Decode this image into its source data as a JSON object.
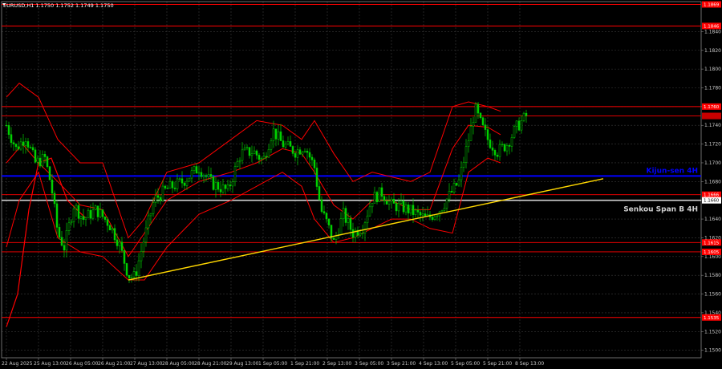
{
  "chart_data": {
    "type": "candlestick",
    "symbol_header": "EURUSD,H1  1.1750 1.1752 1.1749 1.1750",
    "y_axis_ticks": [
      "1.1840",
      "1.1820",
      "1.1800",
      "1.1780",
      "1.1760",
      "1.1740",
      "1.1720",
      "1.1700",
      "1.1680",
      "1.1660",
      "1.1640",
      "1.1620",
      "1.1600",
      "1.1580",
      "1.1560",
      "1.1540",
      "1.1520",
      "1.1500"
    ],
    "x_axis_ticks": [
      "22 Aug 2025",
      "25 Aug 13:00",
      "26 Aug 05:00",
      "26 Aug 21:00",
      "27 Aug 13:00",
      "28 Aug 05:00",
      "28 Aug 21:00",
      "29 Aug 13:00",
      "1 Sep 05:00",
      "1 Sep 21:00",
      "2 Sep 13:00",
      "3 Sep 05:00",
      "3 Sep 21:00",
      "4 Sep 13:00",
      "5 Sep 05:00",
      "5 Sep 21:00",
      "8 Sep 13:00"
    ],
    "ylim": [
      1.1492,
      1.1872
    ],
    "levels": [
      {
        "price": 1.1869,
        "label": "1.1869",
        "color": "#ff0000"
      },
      {
        "price": 1.1846,
        "label": "1.1846",
        "color": "#ff0000"
      },
      {
        "price": 1.176,
        "label": "1.1760",
        "color": "#ff0000"
      },
      {
        "price": 1.175,
        "label": "1.1750",
        "color": "#ff0000"
      },
      {
        "price": 1.1666,
        "label": "1.1666",
        "color": "#ff0000"
      },
      {
        "price": 1.1615,
        "label": "1.1615",
        "color": "#ff0000"
      },
      {
        "price": 1.1605,
        "label": "1.1605",
        "color": "#ff0000"
      },
      {
        "price": 1.1535,
        "label": "1.1535",
        "color": "#ff0000"
      }
    ],
    "kijun": {
      "price": 1.1686,
      "label": "Kijun-sen 4H",
      "color": "#0000ff"
    },
    "senkou": {
      "price": 1.166,
      "label": "Senkou Span B 4H",
      "tag": "1.1660",
      "color": "#d0d0d0"
    },
    "current_price": {
      "price": 1.175,
      "tag": "1.1750"
    },
    "trendline": {
      "from": [
        3.8,
        1.1575
      ],
      "to": [
        18.6,
        1.1683
      ],
      "color": "#ffd700"
    },
    "candle_color": "#00d000",
    "indicator_color": "#ff0000",
    "bands": {
      "upper": [
        [
          0,
          1.177
        ],
        [
          0.4,
          1.1785
        ],
        [
          1.0,
          1.177
        ],
        [
          1.6,
          1.1725
        ],
        [
          2.3,
          1.17
        ],
        [
          3.0,
          1.17
        ],
        [
          3.8,
          1.162
        ],
        [
          4.3,
          1.164
        ],
        [
          5.0,
          1.169
        ],
        [
          6.0,
          1.17
        ],
        [
          7.0,
          1.1725
        ],
        [
          7.8,
          1.1745
        ],
        [
          8.6,
          1.174
        ],
        [
          9.2,
          1.1725
        ],
        [
          9.6,
          1.1745
        ],
        [
          10.2,
          1.171
        ],
        [
          10.8,
          1.168
        ],
        [
          11.4,
          1.169
        ],
        [
          12.0,
          1.1685
        ],
        [
          12.6,
          1.168
        ],
        [
          13.2,
          1.169
        ],
        [
          13.9,
          1.176
        ],
        [
          14.4,
          1.1765
        ],
        [
          15.0,
          1.176
        ],
        [
          15.4,
          1.1755
        ]
      ],
      "middle": [
        [
          0,
          1.17
        ],
        [
          0.5,
          1.172
        ],
        [
          1.0,
          1.17
        ],
        [
          1.6,
          1.168
        ],
        [
          2.3,
          1.1655
        ],
        [
          3.0,
          1.165
        ],
        [
          3.8,
          1.16
        ],
        [
          4.3,
          1.1625
        ],
        [
          5.0,
          1.166
        ],
        [
          6.0,
          1.168
        ],
        [
          7.0,
          1.169
        ],
        [
          7.8,
          1.17
        ],
        [
          8.6,
          1.1715
        ],
        [
          9.2,
          1.171
        ],
        [
          9.6,
          1.169
        ],
        [
          10.2,
          1.1655
        ],
        [
          10.8,
          1.164
        ],
        [
          11.4,
          1.166
        ],
        [
          12.0,
          1.166
        ],
        [
          12.6,
          1.165
        ],
        [
          13.2,
          1.165
        ],
        [
          13.9,
          1.1715
        ],
        [
          14.4,
          1.174
        ],
        [
          15.0,
          1.1738
        ],
        [
          15.4,
          1.173
        ]
      ],
      "lower": [
        [
          0,
          1.161
        ],
        [
          0.4,
          1.166
        ],
        [
          1.0,
          1.169
        ],
        [
          1.6,
          1.162
        ],
        [
          2.3,
          1.1605
        ],
        [
          3.0,
          1.16
        ],
        [
          3.8,
          1.1575
        ],
        [
          4.3,
          1.1575
        ],
        [
          5.0,
          1.161
        ],
        [
          6.0,
          1.1645
        ],
        [
          7.0,
          1.166
        ],
        [
          7.8,
          1.1675
        ],
        [
          8.6,
          1.169
        ],
        [
          9.2,
          1.1675
        ],
        [
          9.6,
          1.164
        ],
        [
          10.2,
          1.1615
        ],
        [
          10.8,
          1.162
        ],
        [
          11.4,
          1.163
        ],
        [
          12.0,
          1.164
        ],
        [
          12.6,
          1.164
        ],
        [
          13.2,
          1.163
        ],
        [
          13.9,
          1.1625
        ],
        [
          14.4,
          1.169
        ],
        [
          15.0,
          1.1705
        ],
        [
          15.4,
          1.17
        ]
      ],
      "ma_long": [
        [
          0,
          1.1525
        ],
        [
          0.35,
          1.156
        ],
        [
          0.7,
          1.165
        ],
        [
          1.0,
          1.17
        ],
        [
          1.4,
          1.1705
        ],
        [
          1.9,
          1.166
        ],
        [
          2.5,
          1.164
        ]
      ]
    },
    "price_path": [
      [
        0.0,
        1.174
      ],
      [
        0.3,
        1.1715
      ],
      [
        0.6,
        1.1728
      ],
      [
        0.9,
        1.17
      ],
      [
        1.2,
        1.1705
      ],
      [
        1.4,
        1.1675
      ],
      [
        1.6,
        1.1625
      ],
      [
        1.8,
        1.161
      ],
      [
        2.1,
        1.1655
      ],
      [
        2.4,
        1.164
      ],
      [
        2.8,
        1.165
      ],
      [
        3.2,
        1.1635
      ],
      [
        3.5,
        1.1615
      ],
      [
        3.8,
        1.158
      ],
      [
        4.0,
        1.1578
      ],
      [
        4.3,
        1.162
      ],
      [
        4.6,
        1.166
      ],
      [
        5.0,
        1.1672
      ],
      [
        5.5,
        1.168
      ],
      [
        6.0,
        1.1695
      ],
      [
        6.4,
        1.1678
      ],
      [
        6.9,
        1.167
      ],
      [
        7.3,
        1.171
      ],
      [
        7.7,
        1.1712
      ],
      [
        8.0,
        1.1702
      ],
      [
        8.3,
        1.1735
      ],
      [
        8.6,
        1.172
      ],
      [
        9.0,
        1.1712
      ],
      [
        9.3,
        1.1718
      ],
      [
        9.6,
        1.1695
      ],
      [
        9.8,
        1.165
      ],
      [
        10.0,
        1.1635
      ],
      [
        10.2,
        1.1615
      ],
      [
        10.5,
        1.1645
      ],
      [
        10.8,
        1.1625
      ],
      [
        11.1,
        1.1632
      ],
      [
        11.4,
        1.1662
      ],
      [
        11.7,
        1.1668
      ],
      [
        12.0,
        1.1655
      ],
      [
        12.4,
        1.1652
      ],
      [
        12.8,
        1.1645
      ],
      [
        13.1,
        1.164
      ],
      [
        13.5,
        1.165
      ],
      [
        13.8,
        1.1665
      ],
      [
        14.1,
        1.168
      ],
      [
        14.3,
        1.171
      ],
      [
        14.5,
        1.174
      ],
      [
        14.6,
        1.1758
      ],
      [
        14.8,
        1.174
      ],
      [
        15.0,
        1.1725
      ],
      [
        15.3,
        1.1712
      ],
      [
        15.6,
        1.172
      ],
      [
        15.9,
        1.1738
      ],
      [
        16.2,
        1.175
      ]
    ]
  }
}
